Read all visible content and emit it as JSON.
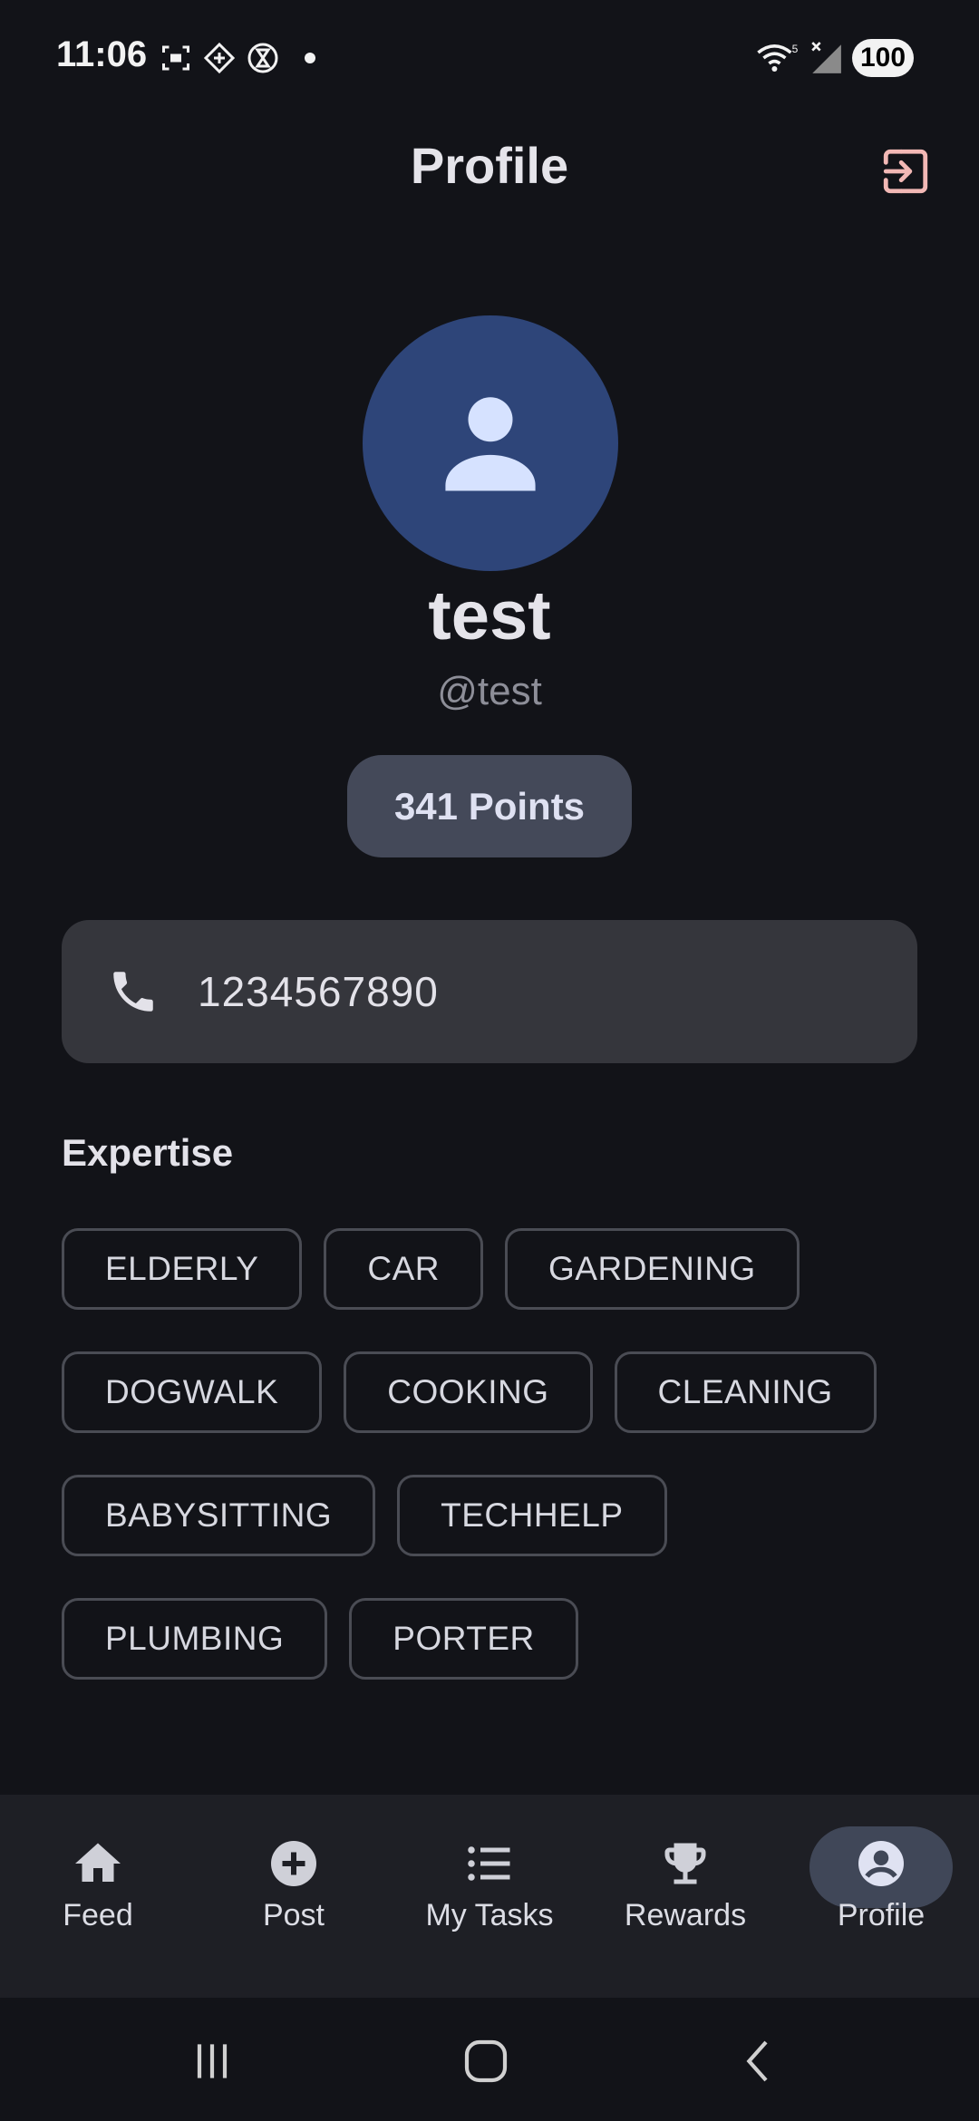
{
  "status_bar": {
    "time": "11:06",
    "battery": "100",
    "wifi_label": "5"
  },
  "header": {
    "title": "Profile",
    "logout_icon": "logout-icon",
    "accent": "#f2b8b5"
  },
  "profile": {
    "avatar_icon": "person-icon",
    "avatar_bg": "#2e4579",
    "display_name": "test",
    "username": "@test",
    "points": "341 Points",
    "phone_icon": "phone-icon",
    "phone": "1234567890"
  },
  "expertise": {
    "title": "Expertise",
    "chips": [
      "ELDERLY",
      "CAR",
      "GARDENING",
      "DOGWALK",
      "COOKING",
      "CLEANING",
      "BABYSITTING",
      "TECHHELP",
      "PLUMBING",
      "PORTER"
    ]
  },
  "bottom_nav": {
    "items": [
      {
        "label": "Feed",
        "icon": "home-icon",
        "active": false
      },
      {
        "label": "Post",
        "icon": "add-circle-icon",
        "active": false
      },
      {
        "label": "My Tasks",
        "icon": "list-icon",
        "active": false
      },
      {
        "label": "Rewards",
        "icon": "trophy-icon",
        "active": false
      },
      {
        "label": "Profile",
        "icon": "account-circle-icon",
        "active": true
      }
    ]
  },
  "system_nav": {
    "recents_icon": "recents-icon",
    "home_icon": "home-button-icon",
    "back_icon": "back-icon"
  }
}
